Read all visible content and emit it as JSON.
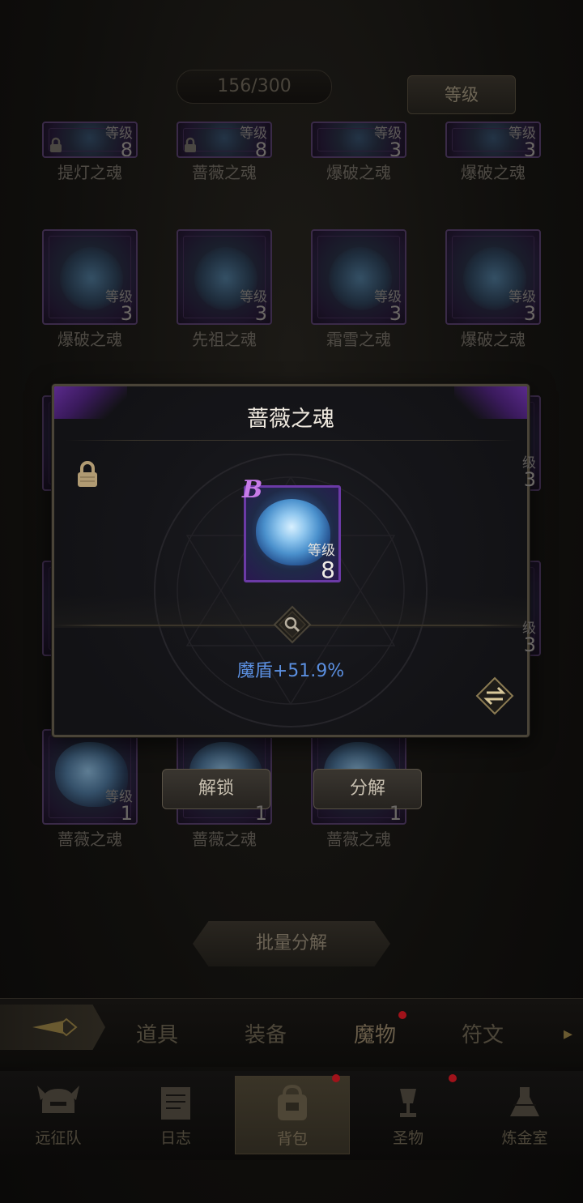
{
  "header": {
    "capacity": "156/300",
    "sort_label": "等级"
  },
  "grid": {
    "row1": [
      {
        "name": "提灯之魂",
        "level_label": "等级",
        "level": "8",
        "locked": true
      },
      {
        "name": "蔷薇之魂",
        "level_label": "等级",
        "level": "8",
        "locked": true
      },
      {
        "name": "爆破之魂",
        "level_label": "等级",
        "level": "3",
        "locked": false
      },
      {
        "name": "爆破之魂",
        "level_label": "等级",
        "level": "3",
        "locked": false
      }
    ],
    "row2": [
      {
        "name": "爆破之魂",
        "level_label": "等级",
        "level": "3"
      },
      {
        "name": "先祖之魂",
        "level_label": "等级",
        "level": "3"
      },
      {
        "name": "霜雪之魂",
        "level_label": "等级",
        "level": "3"
      },
      {
        "name": "爆破之魂",
        "level_label": "等级",
        "level": "3"
      }
    ],
    "row3_partial": [
      {
        "level_label": "级",
        "level": "3"
      }
    ],
    "row4_partial": [
      {
        "level_label": "级",
        "level": "3"
      }
    ],
    "row5": [
      {
        "name": "蔷薇之魂",
        "level_label": "等级",
        "level": "1"
      },
      {
        "name": "蔷薇之魂",
        "level": "1"
      },
      {
        "name": "蔷薇之魂",
        "level": "1"
      }
    ]
  },
  "actions": {
    "unlock_label": "解锁",
    "decompose_label": "分解",
    "batch_decompose_label": "批量分解"
  },
  "modal": {
    "title": "蔷薇之魂",
    "rarity": "B",
    "level_label": "等级",
    "level": "8",
    "stat": "魔盾+51.9%"
  },
  "tabs": [
    {
      "label": "道具"
    },
    {
      "label": "装备"
    },
    {
      "label": "魔物",
      "active": true,
      "badge": true
    },
    {
      "label": "符文"
    }
  ],
  "nav": [
    {
      "label": "远征队",
      "icon": "helmet-icon"
    },
    {
      "label": "日志",
      "icon": "scroll-icon"
    },
    {
      "label": "背包",
      "icon": "backpack-icon",
      "active": true,
      "badge": true
    },
    {
      "label": "圣物",
      "icon": "chalice-icon",
      "badge": true
    },
    {
      "label": "炼金室",
      "icon": "alchemy-icon"
    }
  ],
  "colors": {
    "stat_blue": "#5b8fe0",
    "rarity_purple": "#c77be8",
    "frame_purple": "#6b3aa6",
    "badge_red": "#a0121a"
  }
}
